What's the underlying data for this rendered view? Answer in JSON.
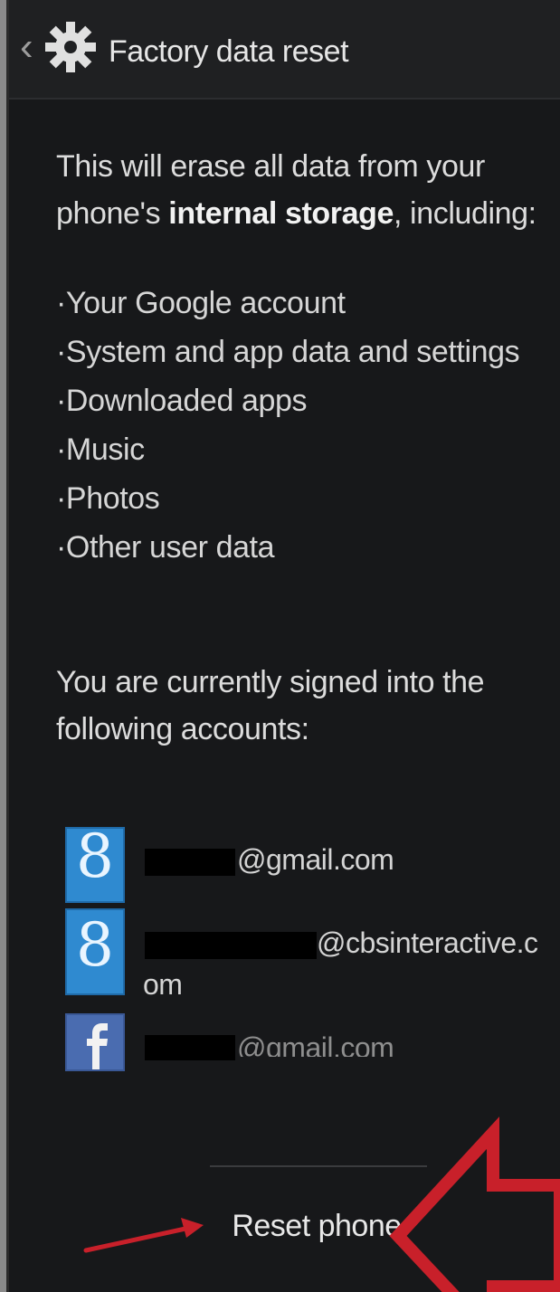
{
  "header": {
    "title": "Factory data reset",
    "back_glyph": "‹",
    "icon": "gear-icon"
  },
  "main": {
    "intro_prefix": "This will erase all data from your phone's ",
    "intro_bold": "internal storage",
    "intro_suffix": ", including:",
    "list_items": [
      "·Your Google account",
      "·System and app data and settings",
      "·Downloaded apps",
      "·Music",
      "·Photos",
      "·Other user data"
    ],
    "accounts_heading": "You are currently signed into the following accounts:",
    "accounts": [
      {
        "icon": "google-account-icon",
        "glyph": "8",
        "text": "@gmail.com",
        "color": "#2f8ad0"
      },
      {
        "icon": "google-account-icon",
        "glyph": "8",
        "text": "@cbsinteractive.c",
        "wrap": "om",
        "color": "#2f8ad0"
      },
      {
        "icon": "facebook-account-icon",
        "text": "@gmail.com",
        "color": "#4a6cb0"
      }
    ]
  },
  "footer": {
    "reset_label": "Reset phone"
  },
  "colors": {
    "background": "#17181a",
    "action_bar": "#1f2022",
    "annotation_red": "#c8202a"
  }
}
